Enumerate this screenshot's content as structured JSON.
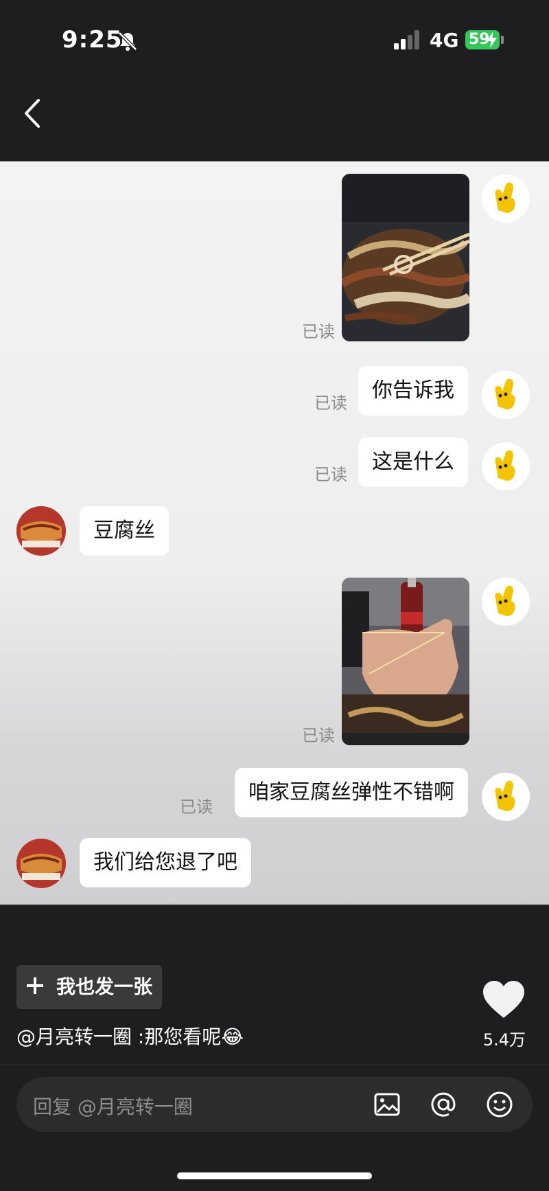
{
  "status": {
    "time": "9:25",
    "network": "4G",
    "battery": "59"
  },
  "chat": {
    "read_label": "已读",
    "messages": [
      {
        "from": "me",
        "kind": "image",
        "desc": "tofu-skin-food-photo"
      },
      {
        "from": "me",
        "kind": "text",
        "text": "你告诉我"
      },
      {
        "from": "me",
        "kind": "text",
        "text": "这是什么"
      },
      {
        "from": "other",
        "kind": "text",
        "text": "豆腐丝"
      },
      {
        "from": "me",
        "kind": "image",
        "desc": "hand-stretching-tofu-photo"
      },
      {
        "from": "me",
        "kind": "text",
        "text": "咱家豆腐丝弹性不错啊"
      },
      {
        "from": "other",
        "kind": "text",
        "text": "我们给您退了吧"
      }
    ]
  },
  "post": {
    "send_button": "我也发一张",
    "caption": "@月亮转一圈 :那您看呢",
    "emoji": "😂",
    "likes": "5.4万"
  },
  "reply": {
    "placeholder": "回复 @月亮转一圈"
  },
  "colors": {
    "accent_green": "#34c759",
    "bubble": "#ffffff",
    "background": "#1e1e20"
  }
}
